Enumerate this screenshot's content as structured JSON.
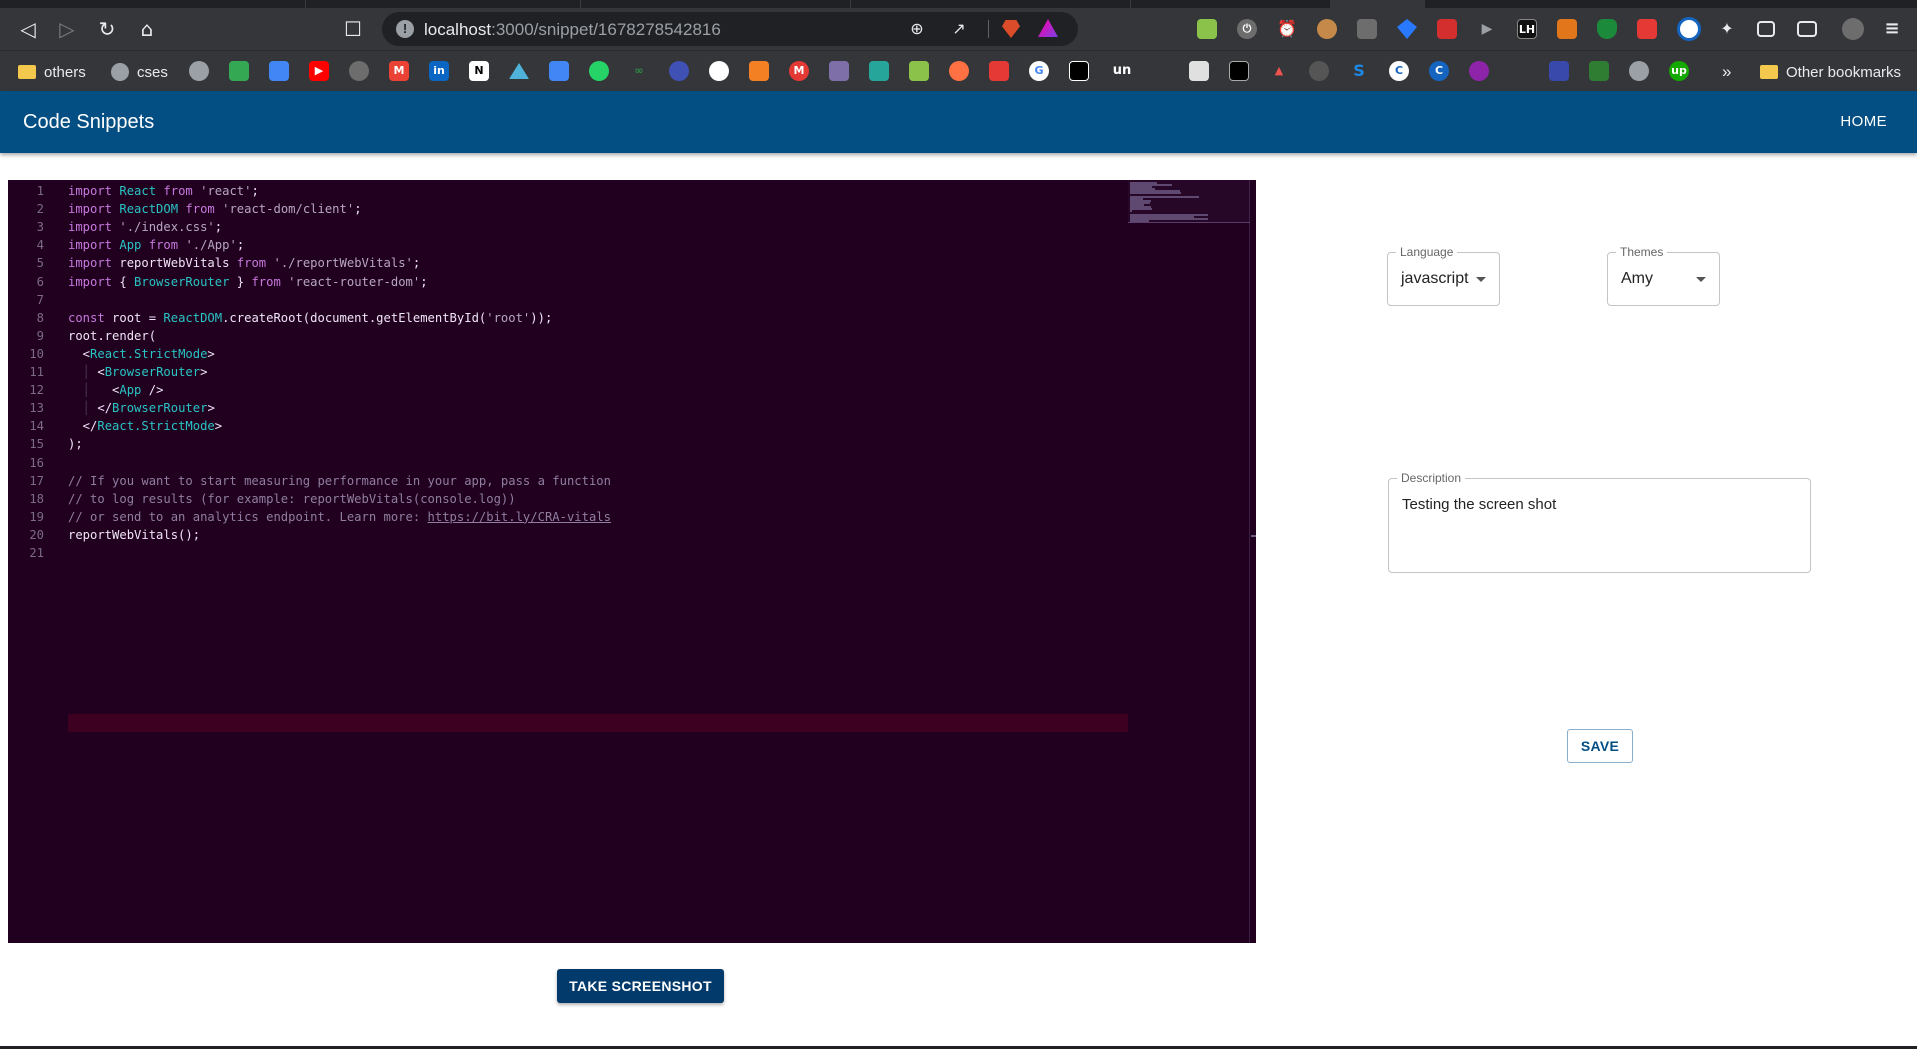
{
  "browser": {
    "url_host": "localhost",
    "url_rest": ":3000/snippet/1678278542816",
    "bookmarks": {
      "others": "others",
      "cses": "cses",
      "other_bookmarks": "Other bookmarks",
      "overflow": "»"
    },
    "toolbar_icons": [
      "back-icon",
      "forward-icon",
      "reload-icon",
      "home-icon",
      "bookmark-icon"
    ],
    "extension_initials": {
      "lh": "LH",
      "un": "un",
      "s": "S",
      "c": "C",
      "up": "up",
      "in": "in",
      "n": "N",
      "m": "M",
      "g": "G"
    }
  },
  "app": {
    "title": "Code Snippets",
    "nav_home": "HOME",
    "brand_color": "#034f84",
    "editor": {
      "background": "#21001f",
      "lines": [
        [
          [
            "kw",
            "import"
          ],
          [
            "id",
            " "
          ],
          [
            "cls",
            "React"
          ],
          [
            "id",
            " "
          ],
          [
            "kw",
            "from"
          ],
          [
            "id",
            " "
          ],
          [
            "str",
            "'react'"
          ],
          [
            "id",
            ";"
          ]
        ],
        [
          [
            "kw",
            "import"
          ],
          [
            "id",
            " "
          ],
          [
            "cls",
            "ReactDOM"
          ],
          [
            "id",
            " "
          ],
          [
            "kw",
            "from"
          ],
          [
            "id",
            " "
          ],
          [
            "str",
            "'react-dom/client'"
          ],
          [
            "id",
            ";"
          ]
        ],
        [
          [
            "kw",
            "import"
          ],
          [
            "id",
            " "
          ],
          [
            "str",
            "'./index.css'"
          ],
          [
            "id",
            ";"
          ]
        ],
        [
          [
            "kw",
            "import"
          ],
          [
            "id",
            " "
          ],
          [
            "cls",
            "App"
          ],
          [
            "id",
            " "
          ],
          [
            "kw",
            "from"
          ],
          [
            "id",
            " "
          ],
          [
            "str",
            "'./App'"
          ],
          [
            "id",
            ";"
          ]
        ],
        [
          [
            "kw",
            "import"
          ],
          [
            "id",
            " reportWebVitals "
          ],
          [
            "kw",
            "from"
          ],
          [
            "id",
            " "
          ],
          [
            "str",
            "'./reportWebVitals'"
          ],
          [
            "id",
            ";"
          ]
        ],
        [
          [
            "kw",
            "import"
          ],
          [
            "id",
            " { "
          ],
          [
            "cls",
            "BrowserRouter"
          ],
          [
            "id",
            " } "
          ],
          [
            "kw",
            "from"
          ],
          [
            "id",
            " "
          ],
          [
            "str",
            "'react-router-dom'"
          ],
          [
            "id",
            ";"
          ]
        ],
        [],
        [
          [
            "kw",
            "const"
          ],
          [
            "id",
            " root = "
          ],
          [
            "cls",
            "ReactDOM"
          ],
          [
            "id",
            ".createRoot(document.getElementById("
          ],
          [
            "str",
            "'root'"
          ],
          [
            "id",
            "));"
          ]
        ],
        [
          [
            "id",
            "root.render("
          ]
        ],
        [
          [
            "id",
            "  <"
          ],
          [
            "tag",
            "React.StrictMode"
          ],
          [
            "id",
            ">"
          ]
        ],
        [
          [
            "guide",
            "  │ "
          ],
          [
            "id",
            "<"
          ],
          [
            "tag",
            "BrowserRouter"
          ],
          [
            "id",
            ">"
          ]
        ],
        [
          [
            "guide",
            "  │   "
          ],
          [
            "id",
            "<"
          ],
          [
            "tag",
            "App"
          ],
          [
            "id",
            " />"
          ]
        ],
        [
          [
            "guide",
            "  │ "
          ],
          [
            "id",
            "</"
          ],
          [
            "tag",
            "BrowserRouter"
          ],
          [
            "id",
            ">"
          ]
        ],
        [
          [
            "id",
            "  </"
          ],
          [
            "tag",
            "React.StrictMode"
          ],
          [
            "id",
            ">"
          ]
        ],
        [
          [
            "id",
            ");"
          ]
        ],
        [],
        [
          [
            "cm",
            "// If you want to start measuring performance in your app, pass a function"
          ]
        ],
        [
          [
            "cm",
            "// to log results (for example: reportWebVitals(console.log))"
          ]
        ],
        [
          [
            "cm",
            "// or send to an analytics endpoint. Learn more: "
          ],
          [
            "link",
            "https://bit.ly/CRA-vitals"
          ]
        ],
        [
          [
            "id",
            "reportWebVitals();"
          ]
        ],
        []
      ],
      "current_line": 21
    },
    "language": {
      "label": "Language",
      "value": "javascript"
    },
    "theme": {
      "label": "Themes",
      "value": "Amy"
    },
    "description": {
      "label": "Description",
      "value": "Testing the screen shot"
    },
    "save_label": "SAVE",
    "screenshot_label": "TAKE SCREENSHOT"
  }
}
